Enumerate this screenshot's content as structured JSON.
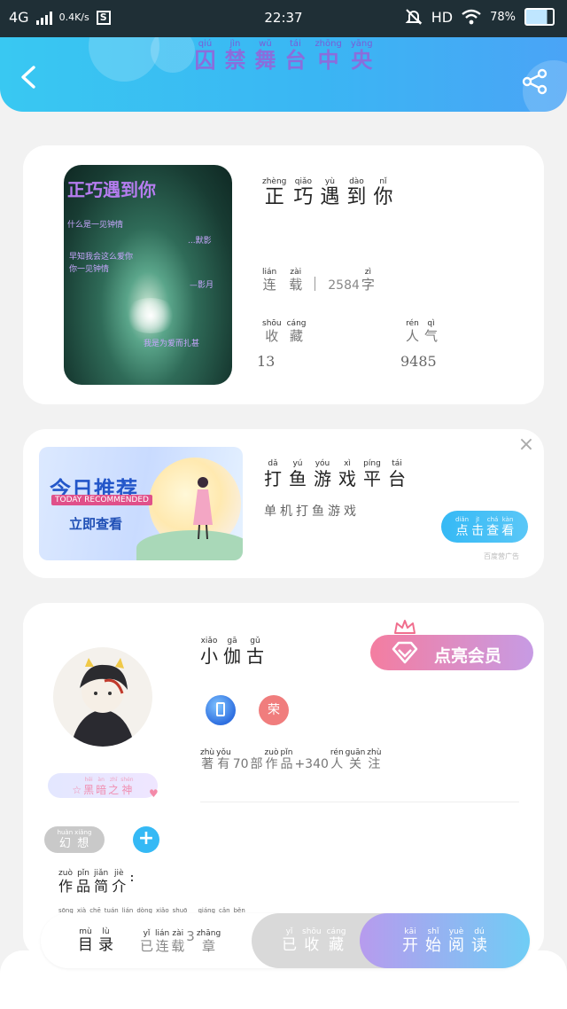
{
  "status_bar": {
    "network": "4G",
    "speed": "0.4K/s",
    "time": "22:37",
    "hd": "HD",
    "battery": "78%",
    "battery_level": 0.78
  },
  "header": {
    "title": [
      {
        "py": "qiú",
        "hz": "囚"
      },
      {
        "py": "jìn",
        "hz": "禁"
      },
      {
        "py": "wǔ",
        "hz": "舞"
      },
      {
        "py": "tái",
        "hz": "台"
      },
      {
        "py": "zhōng",
        "hz": "中"
      },
      {
        "py": "yāng",
        "hz": "央"
      }
    ],
    "accent": "#3ab6f3"
  },
  "book": {
    "cover": {
      "title": "正巧遇到你",
      "lines": [
        "什么是一见钟情",
        "...默影",
        "早知我会这么爱你",
        "你一见钟情",
        "—影月",
        "我是为爱而扎甚"
      ]
    },
    "title": [
      {
        "py": "zhèng",
        "hz": "正"
      },
      {
        "py": "qiǎo",
        "hz": "巧"
      },
      {
        "py": "yù",
        "hz": "遇"
      },
      {
        "py": "dào",
        "hz": "到"
      },
      {
        "py": "nǐ",
        "hz": "你"
      }
    ],
    "status": [
      {
        "py": "lián",
        "hz": "连"
      },
      {
        "py": "zài",
        "hz": "载"
      }
    ],
    "word_count": "2584",
    "word_unit": {
      "py": "zì",
      "hz": "字"
    },
    "favorites_label": [
      {
        "py": "shōu",
        "hz": "收"
      },
      {
        "py": "cáng",
        "hz": "藏"
      }
    ],
    "favorites_value": "13",
    "popularity_label": [
      {
        "py": "rén",
        "hz": "人"
      },
      {
        "py": "qì",
        "hz": "气"
      }
    ],
    "popularity_value": "9485"
  },
  "recommend": {
    "banner_title": "今日推荐",
    "banner_subtitle": "TODAY RECOMMENDED",
    "banner_cta": "立即查看",
    "title": [
      {
        "py": "dǎ",
        "hz": "打"
      },
      {
        "py": "yú",
        "hz": "鱼"
      },
      {
        "py": "yóu",
        "hz": "游"
      },
      {
        "py": "xì",
        "hz": "戏"
      },
      {
        "py": "píng",
        "hz": "平"
      },
      {
        "py": "tái",
        "hz": "台"
      }
    ],
    "desc": [
      {
        "py": "",
        "hz": "单"
      },
      {
        "py": "",
        "hz": "机"
      },
      {
        "py": "",
        "hz": "打"
      },
      {
        "py": "",
        "hz": "鱼"
      },
      {
        "py": "",
        "hz": "游"
      },
      {
        "py": "",
        "hz": "戏"
      }
    ],
    "button": [
      {
        "py": "diǎn",
        "hz": "点"
      },
      {
        "py": "jī",
        "hz": "击"
      },
      {
        "py": "chá",
        "hz": "查"
      },
      {
        "py": "kàn",
        "hz": "看"
      }
    ],
    "ad_tag": "百度营广告",
    "close": "×"
  },
  "author": {
    "name": [
      {
        "py": "xiǎo",
        "hz": "小"
      },
      {
        "py": "gā",
        "hz": "伽"
      },
      {
        "py": "gǔ",
        "hz": "古"
      }
    ],
    "vip_button": "点亮会员",
    "badge_red": "荣",
    "stats": [
      {
        "py": "zhù",
        "hz": "著"
      },
      {
        "py": "yǒu",
        "hz": "有"
      },
      {
        "py": "",
        "hz": "70"
      },
      {
        "py": "",
        "hz": "部"
      },
      {
        "py": "zuò",
        "hz": "作"
      },
      {
        "py": "pǐn",
        "hz": "品"
      },
      {
        "py": "",
        "hz": "+340"
      },
      {
        "py": "rén",
        "hz": "人"
      },
      {
        "py": "guān",
        "hz": "关"
      },
      {
        "py": "zhù",
        "hz": "注"
      }
    ],
    "nickname": [
      {
        "py": "",
        "hz": "☆"
      },
      {
        "py": "hēi",
        "hz": "黑"
      },
      {
        "py": "àn",
        "hz": "暗"
      },
      {
        "py": "zhī",
        "hz": "之"
      },
      {
        "py": "shén",
        "hz": "神"
      }
    ],
    "genre": [
      {
        "py": "huàn",
        "hz": "幻"
      },
      {
        "py": "xiǎng",
        "hz": "想"
      }
    ],
    "add": "+",
    "intro_label": [
      {
        "py": "zuò",
        "hz": "作"
      },
      {
        "py": "pǐn",
        "hz": "品"
      },
      {
        "py": "jiǎn",
        "hz": "简"
      },
      {
        "py": "jiè",
        "hz": "介"
      },
      {
        "py": "",
        "hz": ":"
      }
    ],
    "intro_pinyin": [
      "sōng",
      "xià",
      "chē",
      "tuán",
      "lián",
      "dòng",
      "xiǎo",
      "shuō",
      "",
      "",
      "qiáng",
      "cǎn",
      "běn"
    ]
  },
  "bottom": {
    "toc": [
      {
        "py": "mù",
        "hz": "目"
      },
      {
        "py": "lù",
        "hz": "录"
      }
    ],
    "serial": [
      {
        "py": "yǐ",
        "hz": "已"
      },
      {
        "py": "lián",
        "hz": "连"
      },
      {
        "py": "zài",
        "hz": "载"
      },
      {
        "py": "",
        "hz": "3"
      },
      {
        "py": "zhāng",
        "hz": "章"
      }
    ],
    "collect": [
      {
        "py": "yǐ",
        "hz": "已"
      },
      {
        "py": "shōu",
        "hz": "收"
      },
      {
        "py": "cáng",
        "hz": "藏"
      }
    ],
    "read": [
      {
        "py": "kāi",
        "hz": "开"
      },
      {
        "py": "shǐ",
        "hz": "始"
      },
      {
        "py": "yuè",
        "hz": "阅"
      },
      {
        "py": "dú",
        "hz": "读"
      }
    ]
  }
}
